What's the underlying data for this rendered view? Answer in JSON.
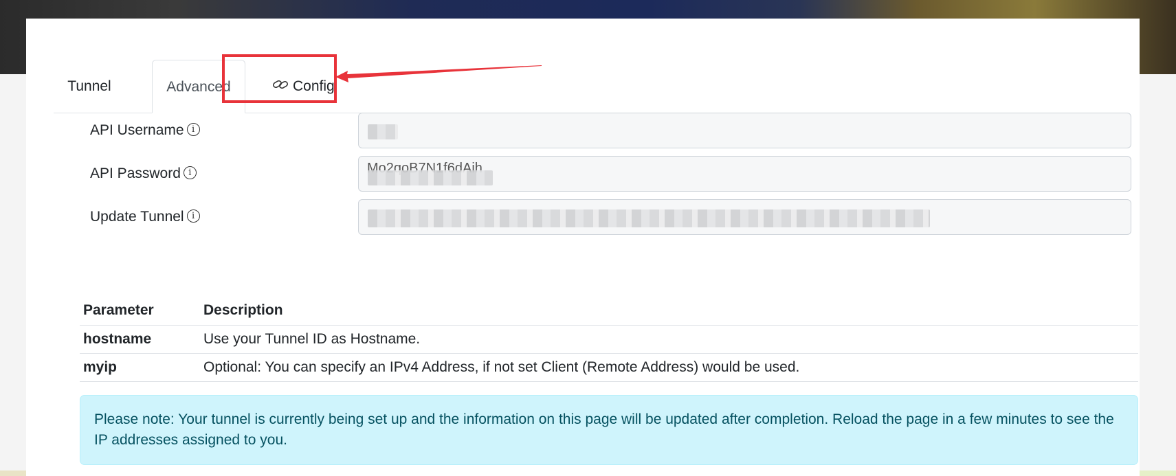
{
  "tabs": [
    {
      "label": "Tunnel"
    },
    {
      "label": "Advanced"
    },
    {
      "label": "Config"
    }
  ],
  "form": {
    "fields": [
      {
        "label": "API Username",
        "value": ""
      },
      {
        "label": "API Password",
        "value": "Mo2qoB7N1f6dAih"
      },
      {
        "label": "Update Tunnel",
        "value": ""
      }
    ]
  },
  "table": {
    "headers": [
      "Parameter",
      "Description"
    ],
    "rows": [
      {
        "name": "hostname",
        "description": "Use your Tunnel ID as Hostname."
      },
      {
        "name": "myip",
        "description": "Optional: You can specify an IPv4 Address, if not set Client (Remote Address) would be used."
      }
    ]
  },
  "alert": {
    "text": "Please note: Your tunnel is currently being set up and the information on this page will be updated after completion. Reload the page in a few minutes to see the IP addresses assigned to you."
  },
  "colors": {
    "highlight": "#e8333a",
    "alert_bg": "#cff4fc",
    "alert_text": "#055160"
  }
}
